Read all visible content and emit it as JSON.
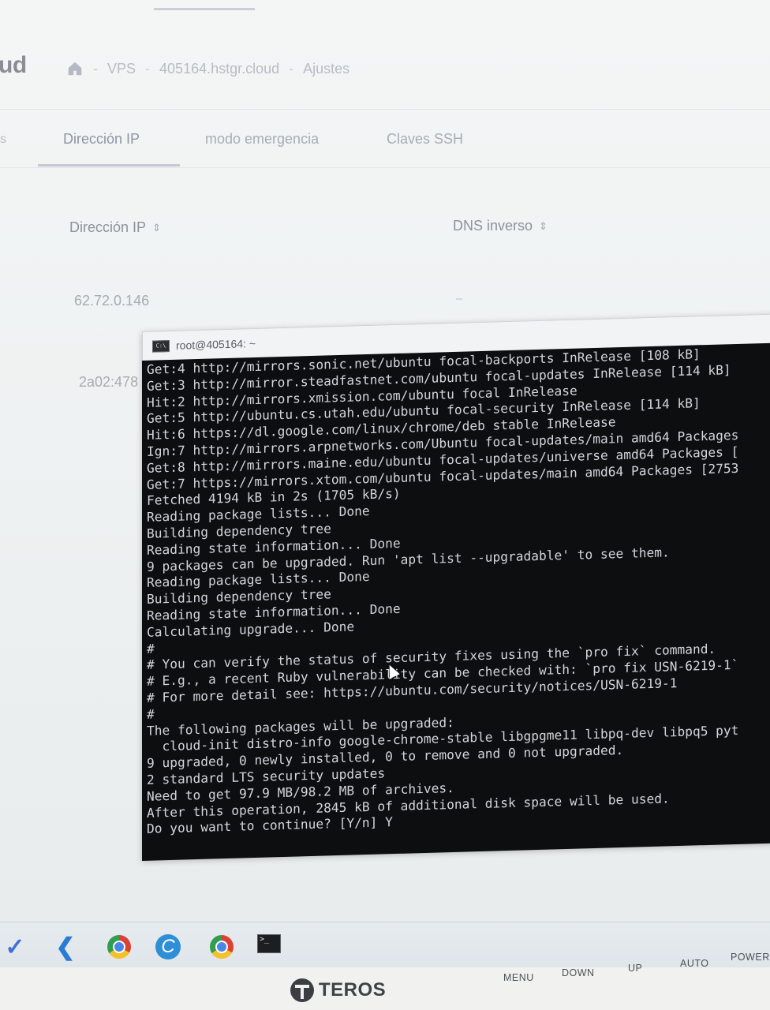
{
  "webpage": {
    "brand_fragment": "ud",
    "breadcrumb": {
      "items": [
        "VPS",
        "405164.hstgr.cloud",
        "Ajustes"
      ],
      "separator": "-"
    },
    "tabs": {
      "cut_fragment": "s",
      "items": [
        "Dirección IP",
        "modo emergencia",
        "Claves SSH"
      ],
      "active": "Dirección IP"
    },
    "table": {
      "headers": [
        "Dirección IP",
        "DNS inverso"
      ],
      "rows": [
        {
          "ip": "62.72.0.146",
          "dns": ""
        },
        {
          "ip": "2a02:478",
          "dns": ""
        }
      ]
    }
  },
  "terminal": {
    "title": "root@405164: ~",
    "icon_text": "C:\\",
    "lines": [
      "Get:4 http://mirrors.sonic.net/ubuntu focal-backports InRelease [108 kB]",
      "Get:3 http://mirror.steadfastnet.com/ubuntu focal-updates InRelease [114 kB]",
      "Hit:2 http://mirrors.xmission.com/ubuntu focal InRelease",
      "Get:5 http://ubuntu.cs.utah.edu/ubuntu focal-security InRelease [114 kB]",
      "Hit:6 https://dl.google.com/linux/chrome/deb stable InRelease",
      "Ign:7 http://mirrors.arpnetworks.com/Ubuntu focal-updates/main amd64 Packages",
      "Get:8 http://mirrors.maine.edu/ubuntu focal-updates/universe amd64 Packages [",
      "Get:7 https://mirrors.xtom.com/ubuntu focal-updates/main amd64 Packages [2753",
      "Fetched 4194 kB in 2s (1705 kB/s)",
      "Reading package lists... Done",
      "Building dependency tree",
      "Reading state information... Done",
      "9 packages can be upgraded. Run 'apt list --upgradable' to see them.",
      "Reading package lists... Done",
      "Building dependency tree",
      "Reading state information... Done",
      "Calculating upgrade... Done",
      "#",
      "# You can verify the status of security fixes using the `pro fix` command.",
      "# E.g., a recent Ruby vulnerability can be checked with: `pro fix USN-6219-1`",
      "# For more detail see: https://ubuntu.com/security/notices/USN-6219-1",
      "#",
      "The following packages will be upgraded:",
      "  cloud-init distro-info google-chrome-stable libgpgme11 libpq-dev libpq5 pyt",
      "9 upgraded, 0 newly installed, 0 to remove and 0 not upgraded.",
      "2 standard LTS security updates",
      "Need to get 97.9 MB/98.2 MB of archives.",
      "After this operation, 2845 kB of additional disk space will be used.",
      "Do you want to continue? [Y/n] Y"
    ]
  },
  "taskbar": {
    "icons": [
      "checkmark-icon",
      "vscode-icon",
      "chrome-icon",
      "c-app-icon",
      "chrome-profile-icon",
      "terminal-icon"
    ]
  },
  "monitor": {
    "brand": "TEROS",
    "buttons": [
      "MENU",
      "DOWN",
      "UP",
      "AUTO",
      "POWER"
    ]
  }
}
